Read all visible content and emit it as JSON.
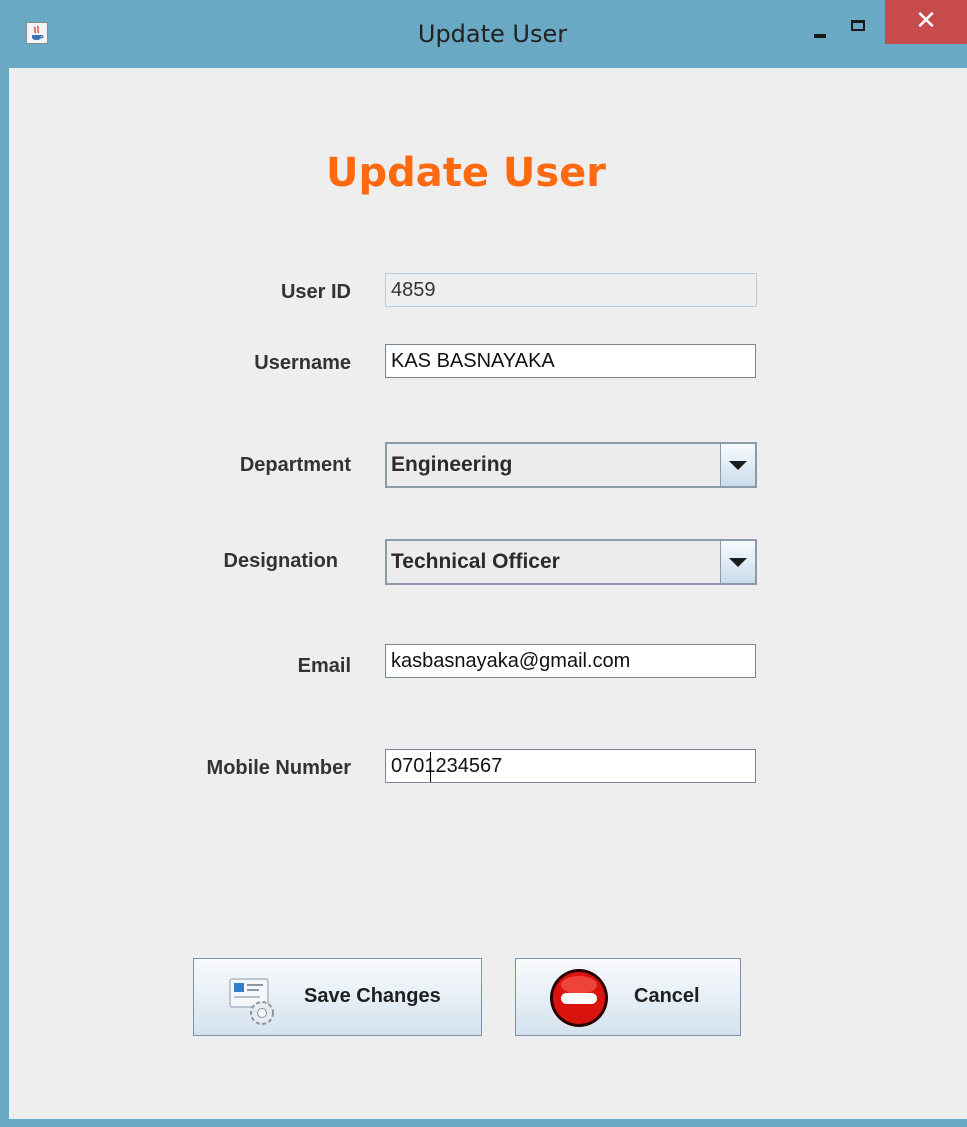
{
  "window": {
    "title": "Update User",
    "close_glyph": "✕",
    "accent_color": "#6aa9c3",
    "close_color": "#c74b4b"
  },
  "form": {
    "heading": "Update User",
    "heading_color": "#ff6a10",
    "user_id": {
      "label": "User ID",
      "value": "4859"
    },
    "username": {
      "label": "Username",
      "value": "KAS BASNAYAKA"
    },
    "department": {
      "label": "Department",
      "selected": "Engineering"
    },
    "designation": {
      "label": "Designation",
      "selected": "Technical Officer"
    },
    "email": {
      "label": "Email",
      "value": "kasbasnayaka@gmail.com"
    },
    "mobile": {
      "label": "Mobile Number",
      "value": "0701234567"
    }
  },
  "buttons": {
    "save": {
      "label": "Save Changes",
      "icon": "save-settings-icon"
    },
    "cancel": {
      "label": "Cancel",
      "icon": "no-entry-icon"
    }
  }
}
